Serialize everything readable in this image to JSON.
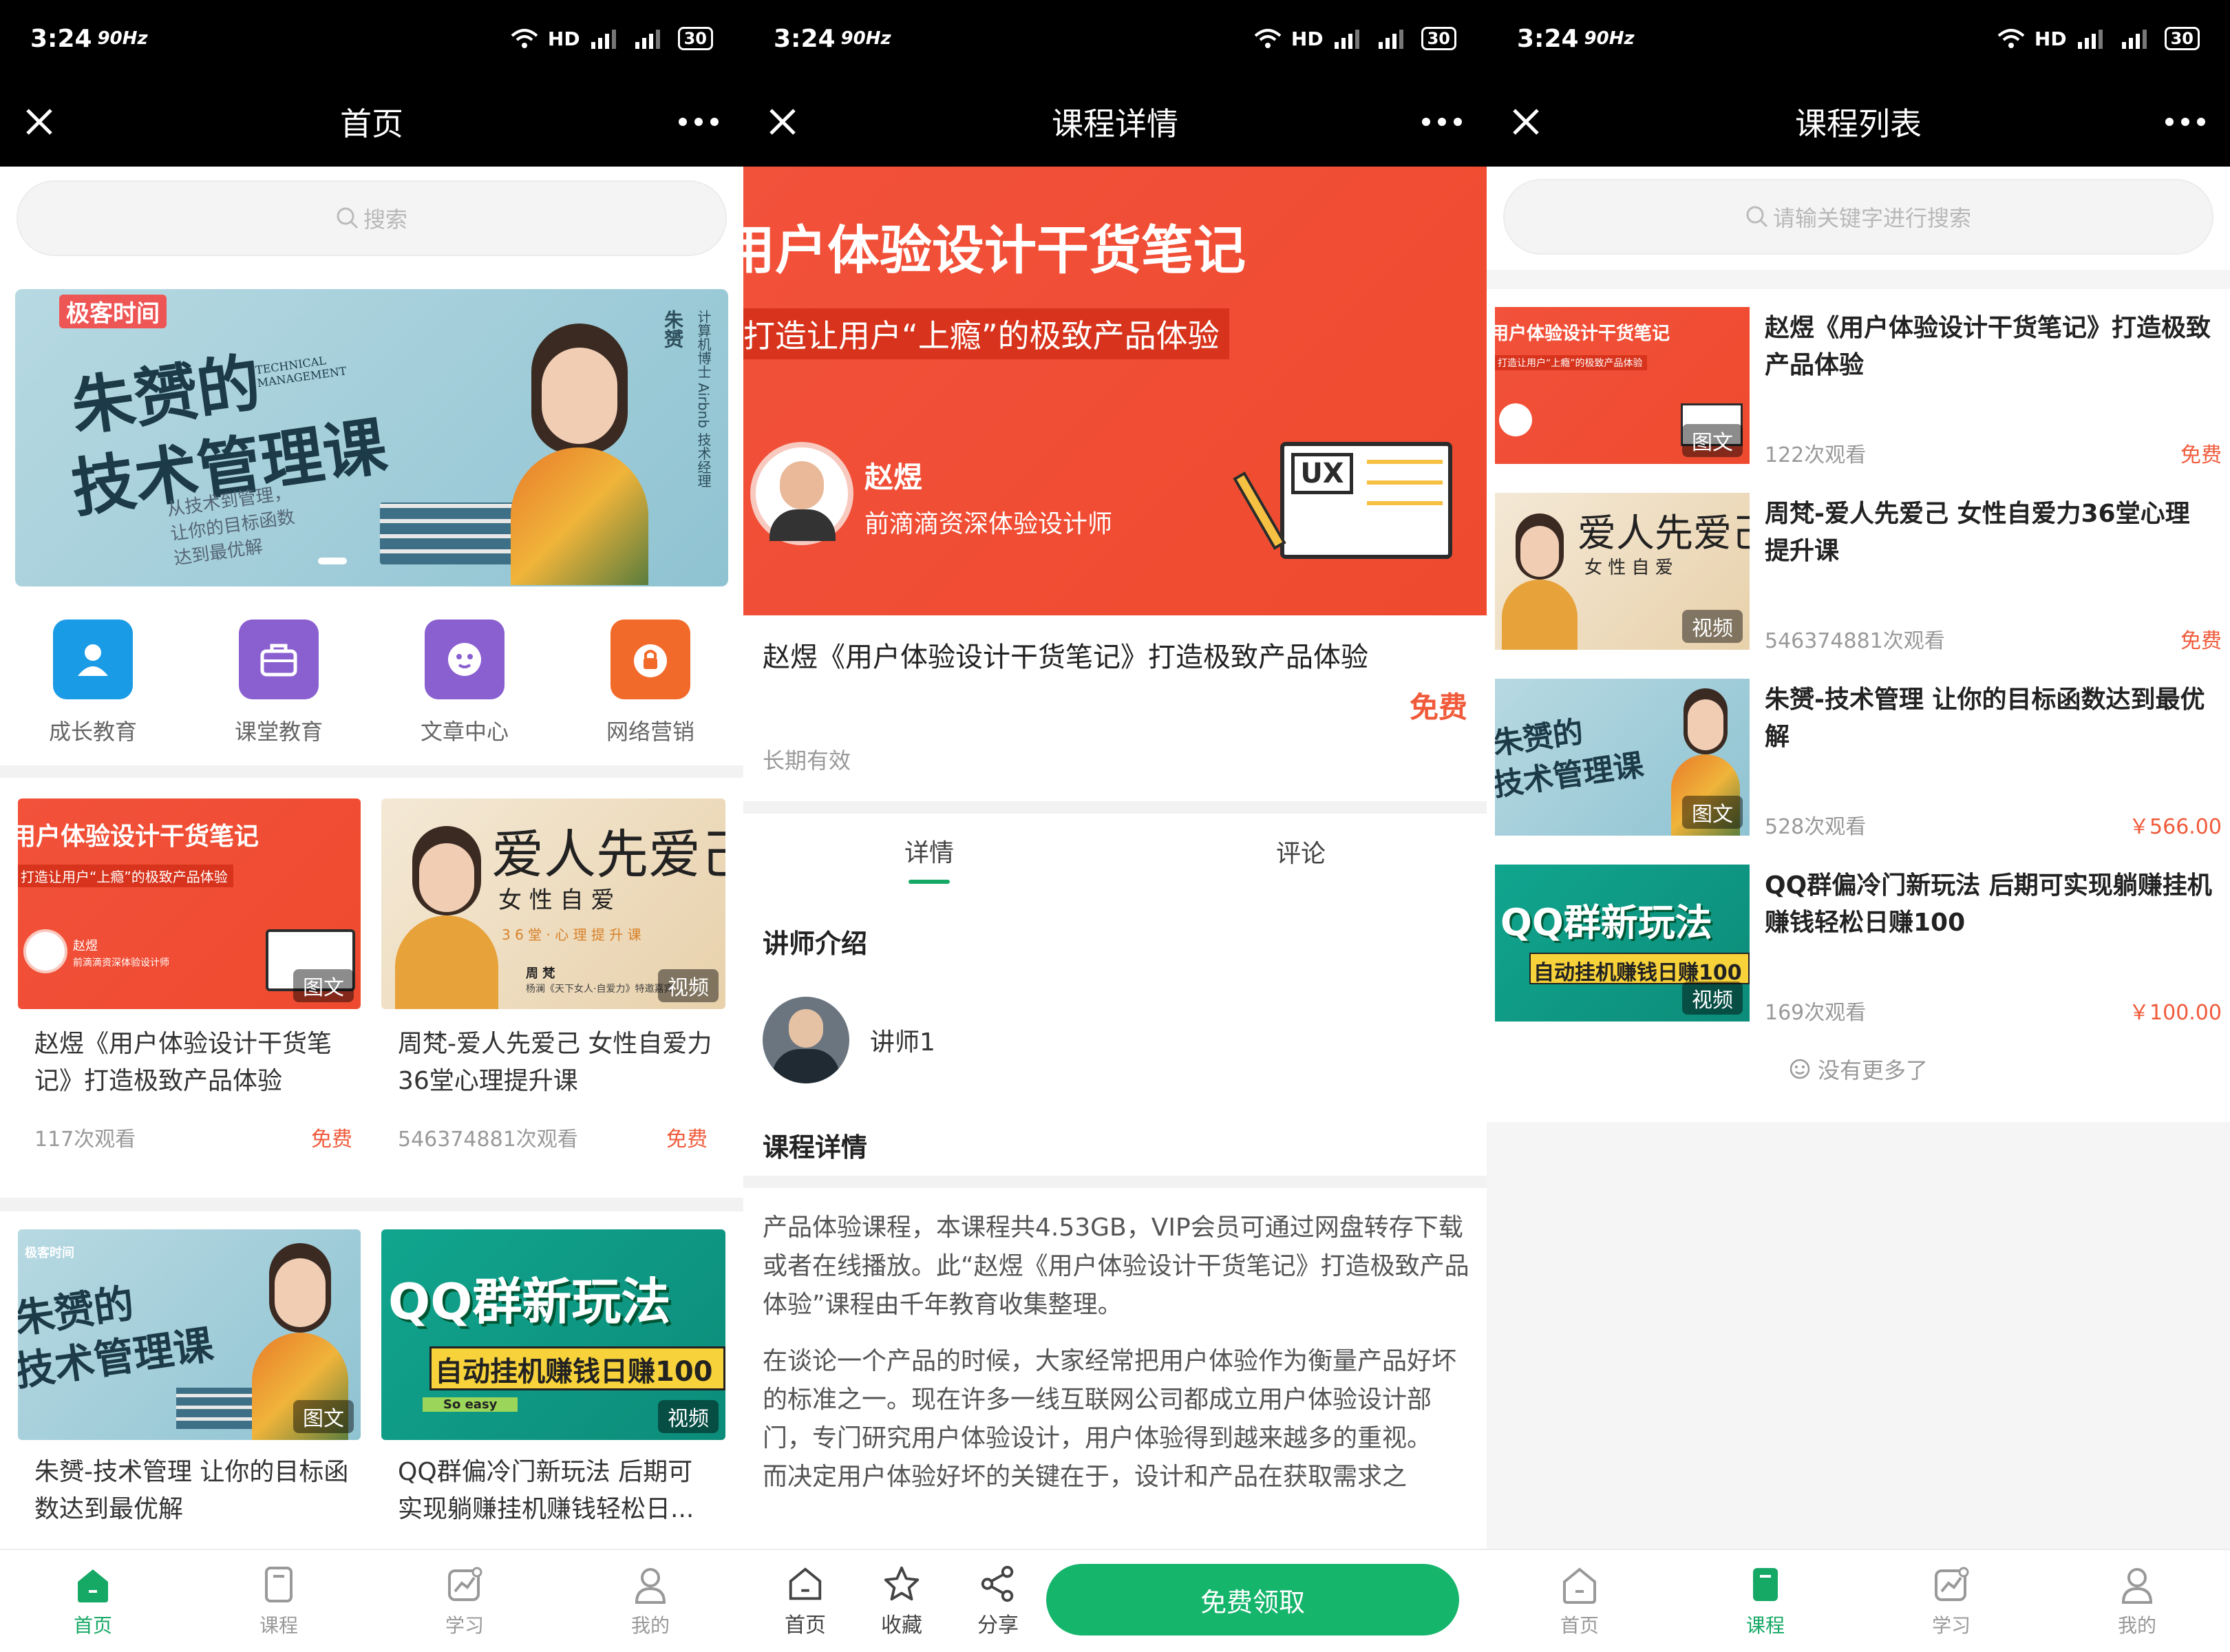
{
  "status": {
    "time": "3:24",
    "hz": "90",
    "net": "HD",
    "battery": "30"
  },
  "colors": {
    "accent": "#16a865",
    "price": "#f05a3a",
    "header": "#000000"
  },
  "screen1": {
    "title": "首页",
    "search_placeholder": "搜索",
    "banner": {
      "logo": "极客时间",
      "title_line1": "朱赟的",
      "title_line2": "技术管理课",
      "title_en": "TECHNICAL MANAGEMENT",
      "sub1": "从技术到管理，",
      "sub2": "让你的目标函数",
      "sub3": "达到最优解",
      "side_name": "朱赟",
      "side_desc": "计算机博士 Airbnb 技术经理"
    },
    "categories": [
      {
        "label": "成长教育",
        "icon": "person-icon",
        "color": "#1a9be6"
      },
      {
        "label": "课堂教育",
        "icon": "bag-icon",
        "color": "#8a5fd0"
      },
      {
        "label": "文章中心",
        "icon": "chat-icon",
        "color": "#8a5fd0"
      },
      {
        "label": "网络营销",
        "icon": "lock-icon",
        "color": "#f26a2a"
      }
    ],
    "courses": [
      {
        "title": "赵煜《用户体验设计干货笔记》打造极致产品体验",
        "views": "117次观看",
        "price": "免费",
        "badge": "图文",
        "thumb_t1": "用户体验设计干货笔记",
        "thumb_t2": "打造让用户“上瘾”的极致产品体验",
        "thumb_name": "赵煜",
        "thumb_role": "前滴滴资深体验设计师"
      },
      {
        "title": "周梵-爱人先爱己 女性自爱力36堂心理提升课",
        "views": "546374881次观看",
        "price": "免费",
        "badge": "视频",
        "thumb_t1": "爱人先爱己",
        "thumb_t2": "女 性 自 爱",
        "thumb_t3": "3 6 堂 · 心 理 提 升 课",
        "thumb_name": "周 梵",
        "thumb_role": "杨澜《天下女人·自爱力》特邀嘉宾"
      },
      {
        "title": "朱赟-技术管理 让你的目标函数达到最优解",
        "badge": "图文",
        "thumb_logo": "极客时间",
        "thumb_t1": "朱赟的",
        "thumb_t2": "技术管理课"
      },
      {
        "title": "QQ群偏冷门新玩法 后期可实现躺赚挂机赚钱轻松日...",
        "badge": "视频",
        "thumb_t1": "QQ群新玩法",
        "thumb_t2": "自动挂机赚钱日赚100",
        "thumb_t3": "So easy"
      }
    ],
    "tabs": [
      {
        "label": "首页"
      },
      {
        "label": "课程"
      },
      {
        "label": "学习"
      },
      {
        "label": "我的"
      }
    ]
  },
  "screen2": {
    "title": "课程详情",
    "hero": {
      "t1": "用户体验设计干货笔记",
      "t2": "打造让用户“上瘾”的极致产品体验",
      "name": "赵煜",
      "role": "前滴滴资深体验设计师"
    },
    "course_title": "赵煜《用户体验设计干货笔记》打造极致产品体验",
    "price": "免费",
    "validity": "长期有效",
    "tab_detail": "详情",
    "tab_comment": "评论",
    "instructor_heading": "讲师介绍",
    "instructor_name": "讲师1",
    "detail_heading": "课程详情",
    "para1": "产品体验课程，本课程共4.53GB，VIP会员可通过网盘转存下载或者在线播放。此“赵煜《用户体验设计干货笔记》打造极致产品体验”课程由千年教育收集整理。",
    "para2": "在谈论一个产品的时候，大家经常把用户体验作为衡量产品好坏的标准之一。现在许多一线互联网公司都成立用户体验设计部门，专门研究用户体验设计，用户体验得到越来越多的重视。",
    "para3": "而决定用户体验好坏的关键在于，设计和产品在获取需求之",
    "bottom": {
      "home": "首页",
      "fav": "收藏",
      "share": "分享",
      "cta": "免费领取"
    }
  },
  "screen3": {
    "title": "课程列表",
    "search_placeholder": "请输关键字进行搜索",
    "items": [
      {
        "title": "赵煜《用户体验设计干货笔记》打造极致产品体验",
        "views": "122次观看",
        "price": "免费",
        "badge": "图文"
      },
      {
        "title": "周梵-爱人先爱己 女性自爱力36堂心理提升课",
        "views": "546374881次观看",
        "price": "免费",
        "badge": "视频"
      },
      {
        "title": "朱赟-技术管理 让你的目标函数达到最优解",
        "views": "528次观看",
        "price": "￥566.00",
        "badge": "图文"
      },
      {
        "title": "QQ群偏冷门新玩法 后期可实现躺赚挂机赚钱轻松日赚100",
        "views": "169次观看",
        "price": "￥100.00",
        "badge": "视频"
      }
    ],
    "no_more": "没有更多了",
    "tabs": [
      {
        "label": "首页"
      },
      {
        "label": "课程"
      },
      {
        "label": "学习"
      },
      {
        "label": "我的"
      }
    ]
  }
}
